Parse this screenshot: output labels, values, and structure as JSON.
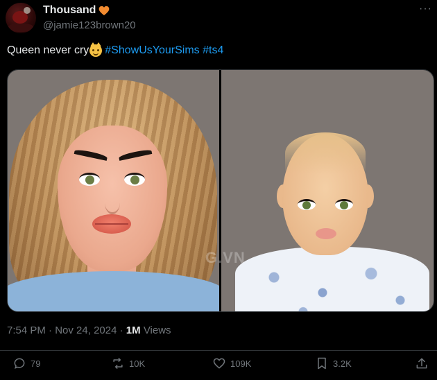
{
  "user": {
    "display_name": "Thousand",
    "handle": "@jamie123brown20",
    "badge_icon": "orange-heart-icon"
  },
  "tweet": {
    "text": "Queen never cry",
    "emoji": "smiling-cat-emoji",
    "hashtags": [
      "#ShowUsYourSims",
      "#ts4"
    ],
    "watermark": "G.VN"
  },
  "meta": {
    "time": "7:54 PM",
    "dot": "·",
    "date": "Nov 24, 2024",
    "views_count": "1M",
    "views_label": "Views"
  },
  "actions": {
    "replies": "79",
    "reposts": "10K",
    "likes": "109K",
    "bookmarks": "3.2K"
  },
  "colors": {
    "background": "#000000",
    "text": "#e7e9ea",
    "secondary": "#71767b",
    "link": "#1d9bf0",
    "heart": "#f28b30"
  }
}
